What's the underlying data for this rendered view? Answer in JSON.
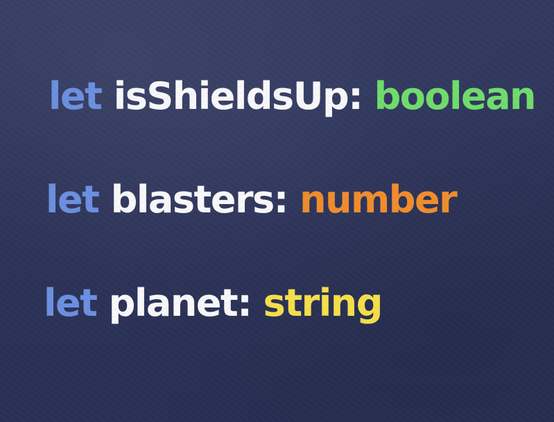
{
  "lines": [
    {
      "keyword": "let",
      "name": "isShieldsUp:",
      "type": "boolean",
      "type_color": "#6fdc6a"
    },
    {
      "keyword": "let",
      "name": "blasters:",
      "type": "number",
      "type_color": "#f08c2c"
    },
    {
      "keyword": "let",
      "name": "planet:",
      "type": "string",
      "type_color": "#f4de4a"
    }
  ],
  "colors": {
    "keyword": "#6b8fe0",
    "name": "#f7f7f9",
    "background": "#2c3358"
  }
}
